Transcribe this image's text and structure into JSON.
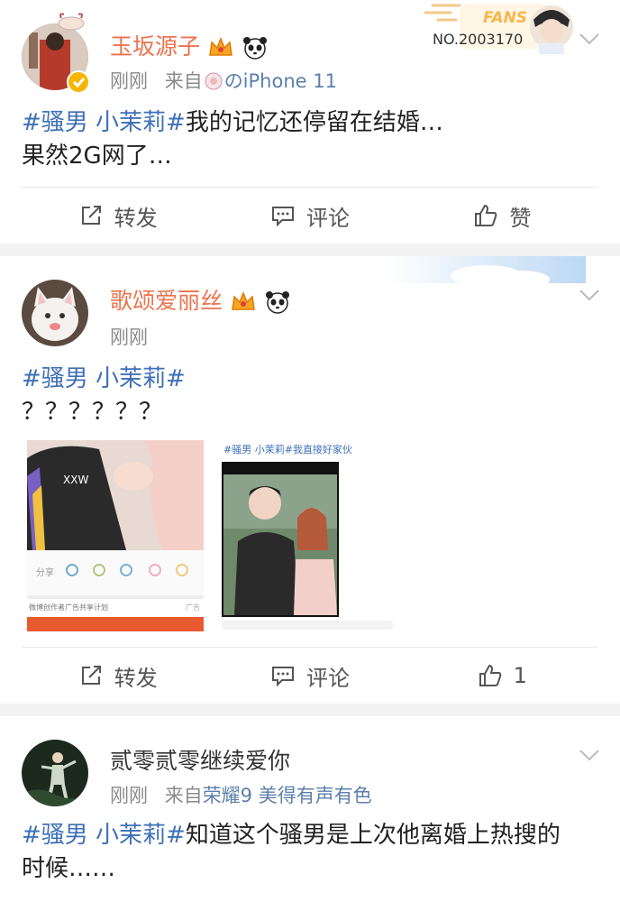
{
  "posts": [
    {
      "user": "玉坂源子",
      "time": "刚刚",
      "from_prefix": "来自",
      "from_source": "のiPhone 11",
      "topic": "#骚男 小茉莉#",
      "text_after_topic": "我的记忆还停留在结婚…",
      "line2": "果然2G网了…",
      "fans_badge": {
        "label": "FANS",
        "number": "NO.2003170"
      },
      "actions": {
        "repost": "转发",
        "comment": "评论",
        "like": "赞"
      }
    },
    {
      "user": "歌颂爱丽丝",
      "time": "刚刚",
      "topic": "#骚男 小茉莉#",
      "line2": "？？？？？？",
      "image2_caption": "#骚男 小茉莉#我直接好家伙",
      "image1_share_label": "分享",
      "image1_ad_text": "微博创作者广告共享计划",
      "image1_ad_tag": "广告",
      "actions": {
        "repost": "转发",
        "comment": "评论",
        "like": "1"
      }
    },
    {
      "user": "贰零贰零继续爱你",
      "time": "刚刚",
      "from_prefix": "来自",
      "from_source": "荣耀9 美得有声有色",
      "topic": "#骚男 小茉莉#",
      "text_after_topic": "知道这个骚男是上次他离婚上热搜的",
      "line2": "时候……"
    }
  ],
  "colors": {
    "username": "#eb7350",
    "topic": "#3d70b8",
    "source": "#5c7fab",
    "meta": "#8a8a8a"
  },
  "icons": [
    "chevron-down-icon",
    "repost-icon",
    "comment-icon",
    "like-icon",
    "verified-icon",
    "crown-icon",
    "panda-icon"
  ]
}
